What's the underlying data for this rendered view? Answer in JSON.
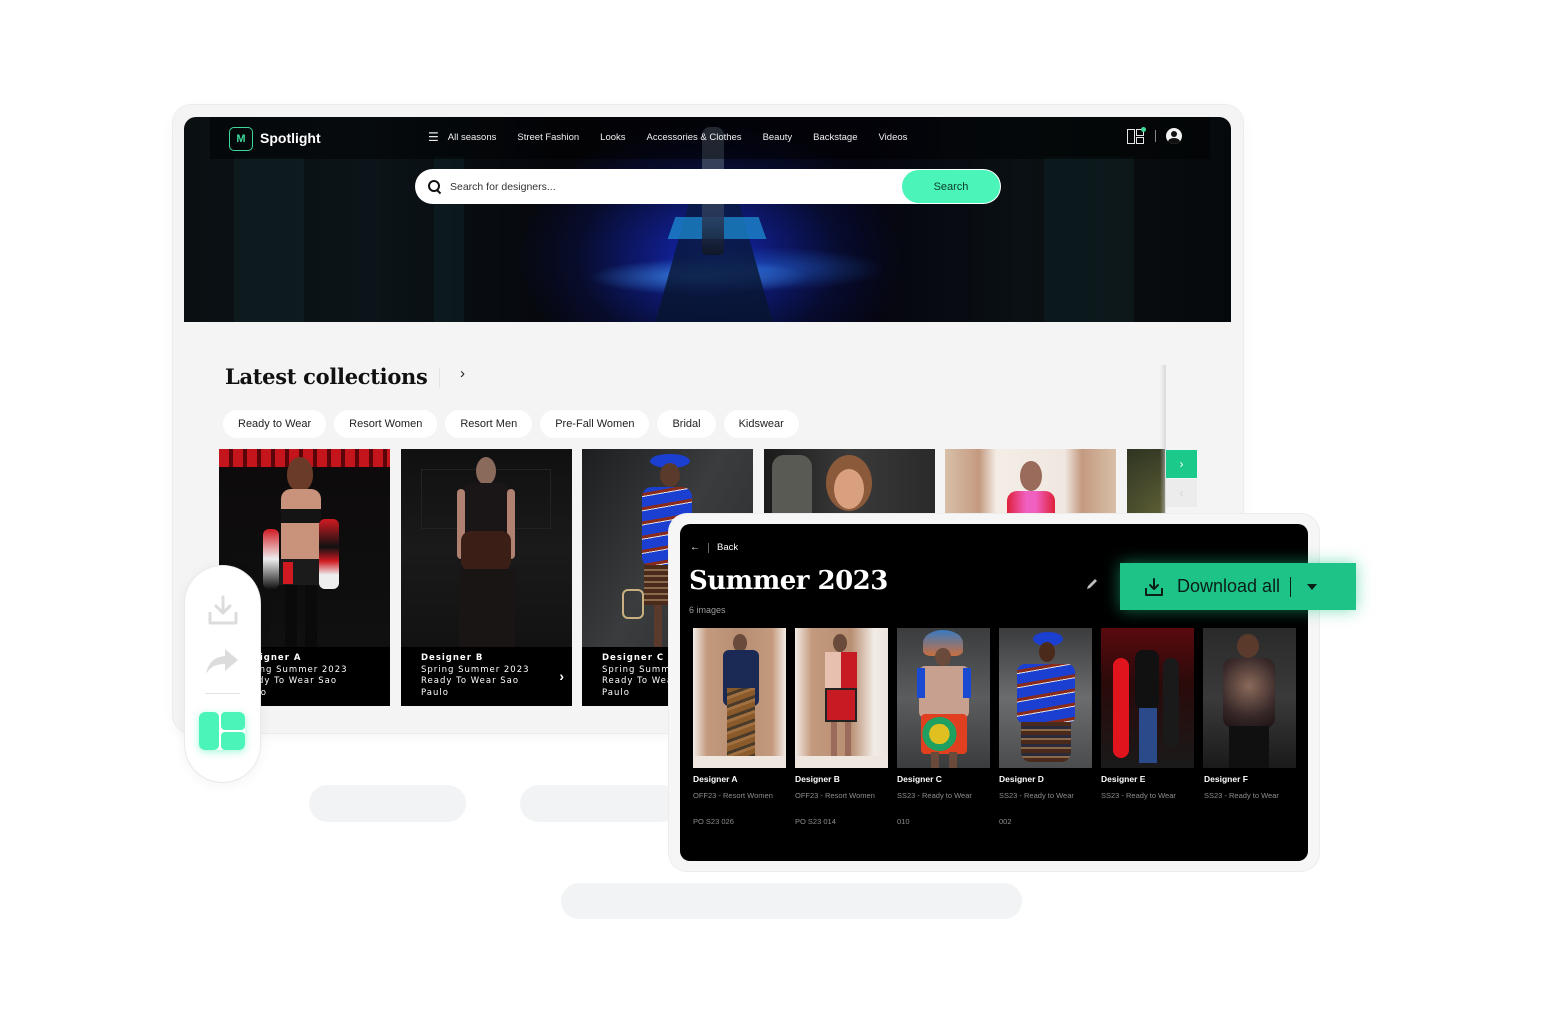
{
  "header": {
    "brand": "Spotlight",
    "logo_glyph": "M",
    "nav_items": [
      "All seasons",
      "Street Fashion",
      "Looks",
      "Accessories & Clothes",
      "Beauty",
      "Backstage",
      "Videos"
    ],
    "menu_icon": "☰",
    "search_placeholder": "Search for designers...",
    "search_button": "Search"
  },
  "collections": {
    "title": "Latest collections",
    "chevron": "›",
    "chips": [
      "Ready to Wear",
      "Resort Women",
      "Resort Men",
      "Pre-Fall Women",
      "Bridal",
      "Kidswear"
    ],
    "cards": [
      {
        "designer": "Designer A",
        "line1": "Spring Summer 2023",
        "line2": "Ready To Wear Sao",
        "line3": "Paulo"
      },
      {
        "designer": "Designer B",
        "line1": "Spring Summer 2023",
        "line2": "Ready To Wear Sao",
        "line3": "Paulo"
      },
      {
        "designer": "Designer C",
        "line1": "Spring Summer 2023",
        "line2": "Ready To Wear Sao",
        "line3": "Paulo"
      }
    ],
    "card_chevron": "›",
    "next_glyph": "›",
    "prev_glyph": "‹"
  },
  "panel": {
    "back_arrow": "←",
    "back_label": "Back",
    "title": "Summer 2023",
    "count": "6 images",
    "download_label": "Download all",
    "images": [
      {
        "designer": "Designer  A",
        "collection": "OFF23 - Resort Women",
        "code": "PO S23 026"
      },
      {
        "designer": "Designer  B",
        "collection": "OFF23 - Resort Women",
        "code": "PO S23 014"
      },
      {
        "designer": "Designer C",
        "collection": "SS23 - Ready to Wear",
        "code": "010"
      },
      {
        "designer": "Designer D",
        "collection": "SS23 - Ready to Wear",
        "code": "002"
      },
      {
        "designer": "Designer  E",
        "collection": "SS23 - Ready to Wear",
        "code": ""
      },
      {
        "designer": "Designer F",
        "collection": "SS23 - Ready to Wear",
        "code": ""
      }
    ]
  },
  "colors": {
    "accent": "#4bf4b8",
    "accent_dark": "#1ec487",
    "panel_bg": "#000000"
  }
}
